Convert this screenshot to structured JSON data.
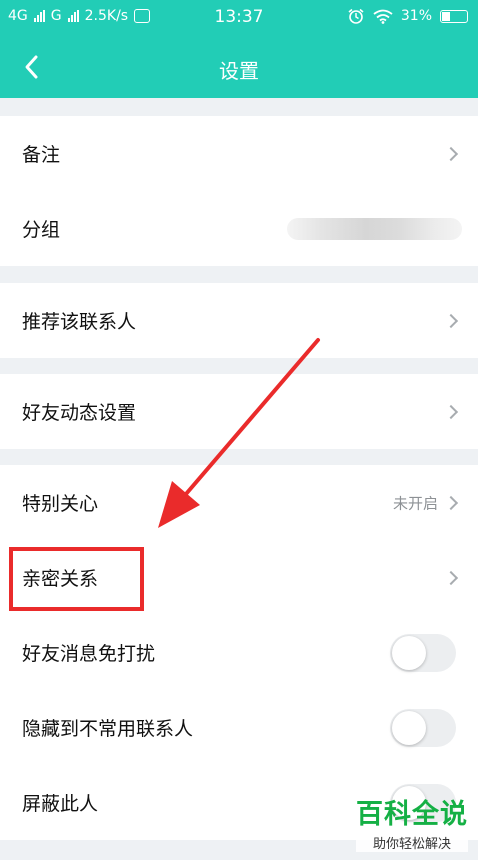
{
  "status_bar": {
    "network_1": "4G",
    "network_2": "G",
    "speed": "2.5K/s",
    "time": "13:37",
    "battery": "31%"
  },
  "header": {
    "title": "设置"
  },
  "groups": {
    "g1": {
      "remark": "备注",
      "group": "分组"
    },
    "g2": {
      "recommend": "推荐该联系人"
    },
    "g3": {
      "moments": "好友动态设置"
    },
    "g4": {
      "special_care": "特别关心",
      "special_care_value": "未开启",
      "intimate": "亲密关系",
      "dnd": "好友消息免打扰",
      "hide": "隐藏到不常用联系人",
      "block": "屏蔽此人"
    }
  },
  "toggles": {
    "dnd": false,
    "hide": false,
    "block": false
  },
  "watermark": {
    "title": "百科全说",
    "subtitle": "助你轻松解决"
  },
  "colors": {
    "accent": "#22cdb6",
    "highlight": "#ea2b2b",
    "watermark": "#15b045"
  }
}
